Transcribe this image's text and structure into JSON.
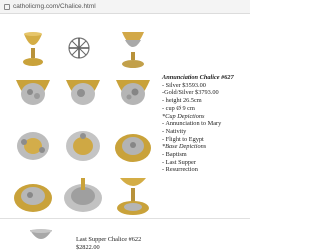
{
  "browser": {
    "url": "catholicmg.com/Chalice.html"
  },
  "product": {
    "title": "Annunciation Chalice #627",
    "lines": [
      "- Silver $3593.00",
      "-Gold/Silver $3793.00",
      "- height 26.5cm",
      "- cup Ø 9 cm",
      "*Cup Depictions"
    ],
    "cup_depictions": [
      "- Annunciation to Mary",
      "- Nativity",
      "- Flight to Egypt"
    ],
    "base_heading": "*Base Depictions",
    "base_depictions": [
      "- Baptism",
      "- Last Supper",
      "- Resurrection"
    ]
  },
  "next_product": {
    "title": "Last Supper Chalice #622",
    "price": "$2822.00"
  },
  "images": [
    {
      "name": "chalice-full-gold"
    },
    {
      "name": "chalice-bottom-cross-emblem"
    },
    {
      "name": "chalice-side-view"
    },
    {
      "name": "chalice-cup-relief-1"
    },
    {
      "name": "chalice-cup-relief-2"
    },
    {
      "name": "chalice-cup-relief-3"
    },
    {
      "name": "chalice-node-detail-1"
    },
    {
      "name": "chalice-node-detail-2"
    },
    {
      "name": "chalice-base-relief-1"
    },
    {
      "name": "chalice-base-relief-2"
    },
    {
      "name": "chalice-base-relief-3"
    },
    {
      "name": "chalice-base-silver"
    },
    {
      "name": "chalice-base-angle"
    }
  ],
  "colors": {
    "gold": "#c9a23a",
    "silver": "#b8b8b8",
    "dark": "#5a4a2a"
  }
}
